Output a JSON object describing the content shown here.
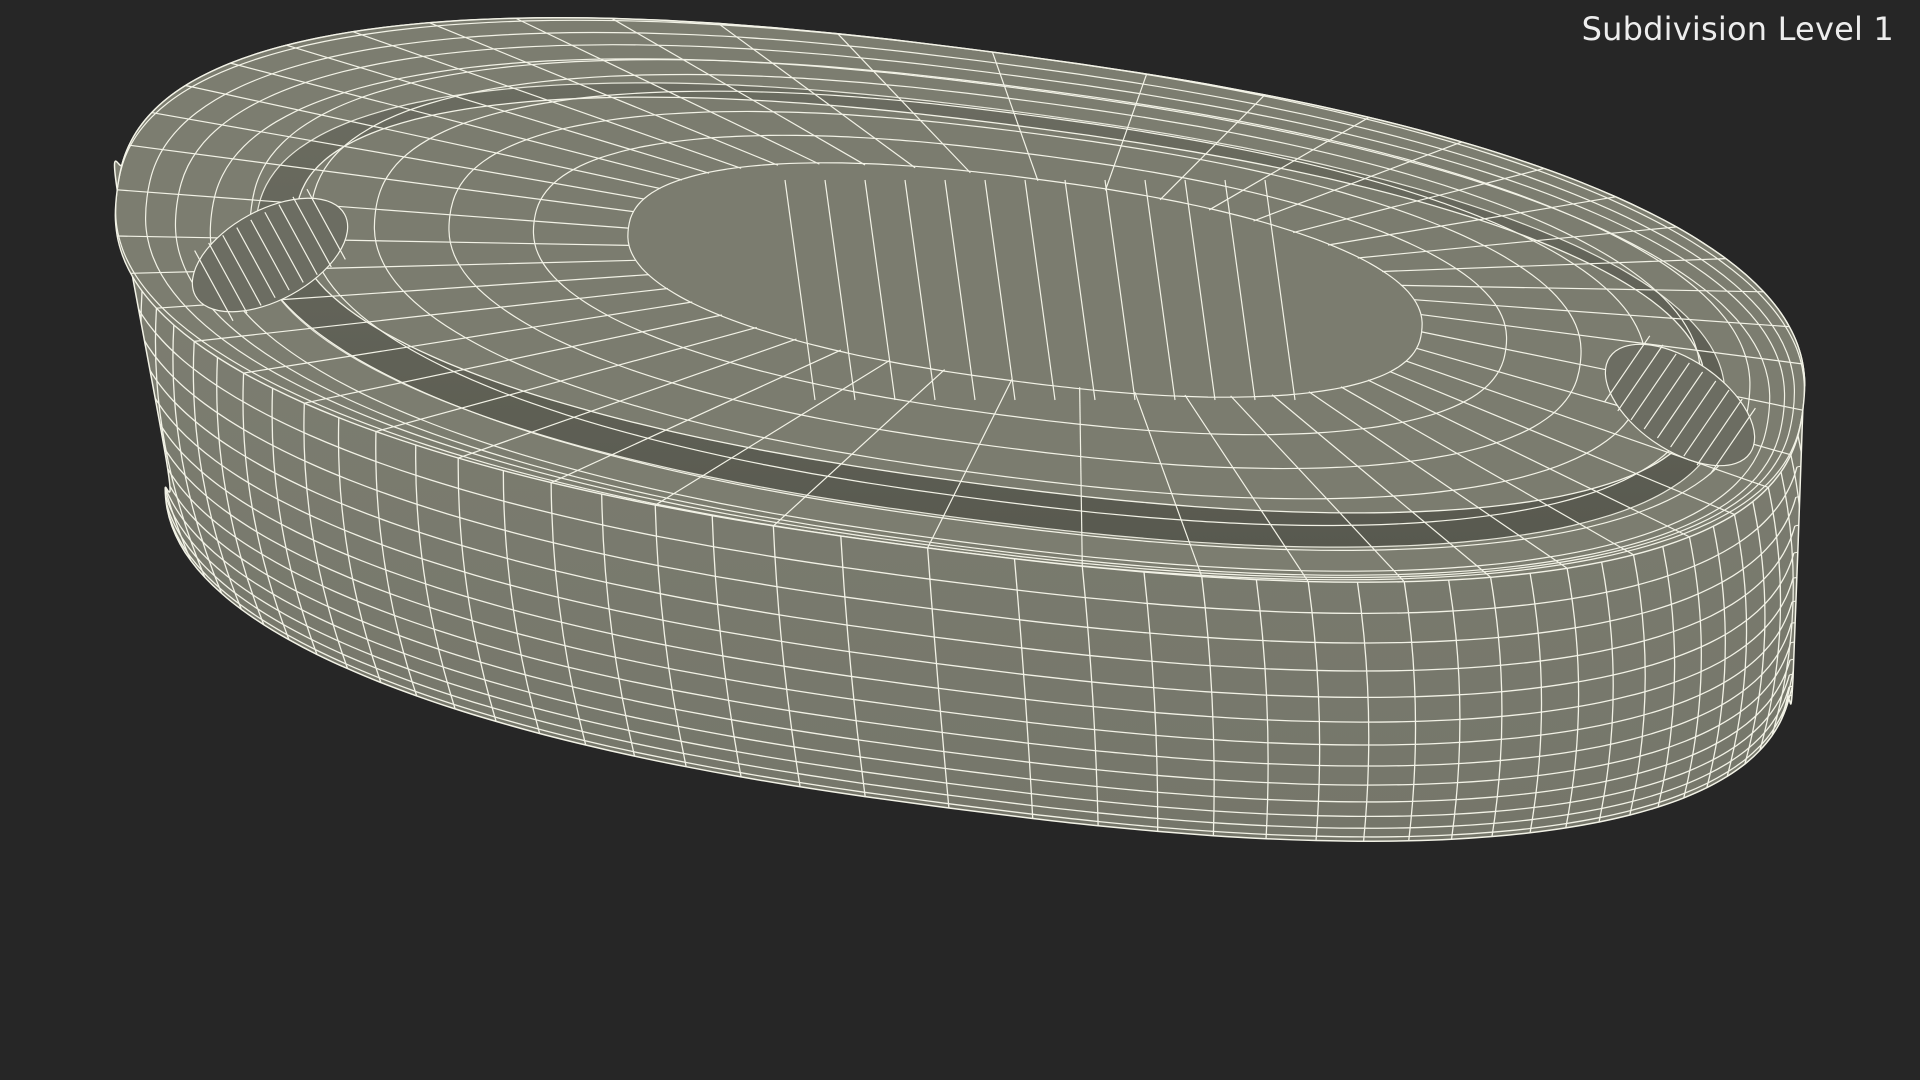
{
  "viewport": {
    "caption": "Subdivision Level 1",
    "background_color": "#262626",
    "mesh_fill_color": "#7b7c6f",
    "mesh_shadow_color": "#5f6055",
    "wireframe_color": "#f2f2e6"
  },
  "model": {
    "shape": "oval-disc-with-recessed-top",
    "display_mode": "wireframe-on-shaded"
  }
}
